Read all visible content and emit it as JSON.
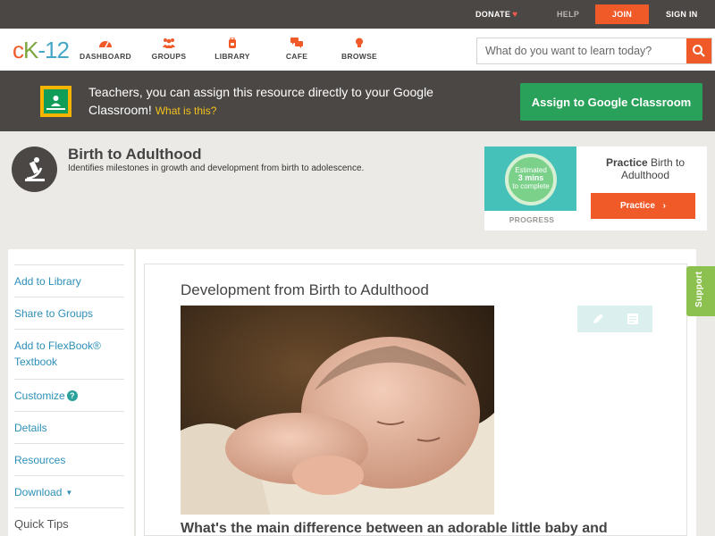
{
  "topbar": {
    "donate": "DONATE",
    "help": "HELP",
    "join": "JOIN",
    "signin": "SIGN IN"
  },
  "logo": {
    "text": "cK-12"
  },
  "nav": {
    "items": [
      {
        "label": "DASHBOARD",
        "icon": "gauge-icon"
      },
      {
        "label": "GROUPS",
        "icon": "people-icon"
      },
      {
        "label": "LIBRARY",
        "icon": "backpack-icon"
      },
      {
        "label": "CAFE",
        "icon": "chat-bubbles-icon"
      },
      {
        "label": "BROWSE",
        "icon": "lightbulb-icon"
      }
    ],
    "search_placeholder": "What do you want to learn today?"
  },
  "banner": {
    "message": "Teachers, you can assign this resource directly to your Google Classroom!",
    "what_link": "What is this?",
    "assign_button": "Assign to Google Classroom"
  },
  "concept": {
    "title": "Birth to Adulthood",
    "description": "Identifies milestones in growth and development from birth to adolescence.",
    "icon": "microscope-icon"
  },
  "practice": {
    "estimated": "Estimated",
    "mins": "3 mins",
    "to_complete": "to complete",
    "progress_label": "PROGRESS",
    "title_bold": "Practice",
    "title_rest": " Birth to Adulthood",
    "button": "Practice"
  },
  "sidebar": {
    "items": [
      {
        "label": "Add to Library"
      },
      {
        "label": "Share to Groups"
      },
      {
        "label": "Add to FlexBook® Textbook"
      },
      {
        "label": "Customize"
      },
      {
        "label": "Details"
      },
      {
        "label": "Resources"
      },
      {
        "label": "Download"
      }
    ],
    "quick_tips": "Quick Tips"
  },
  "article": {
    "title": "Development from Birth to Adulthood",
    "lead": "What's the main difference between an adorable little baby and"
  },
  "support": {
    "label": "Support"
  },
  "colors": {
    "accent": "#f05a29",
    "dark": "#4a4745",
    "link": "#2d8fb7",
    "green": "#2aa15a"
  }
}
